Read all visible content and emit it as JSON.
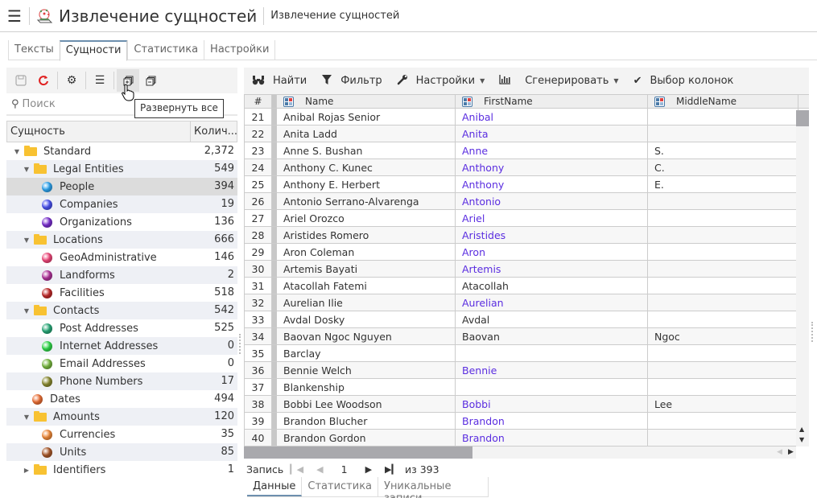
{
  "header": {
    "menu_icon": "hamburger-icon",
    "logo_icon": "entity-extraction-logo-icon",
    "title": "Извлечение сущностей",
    "subtitle": "Извлечение сущностей"
  },
  "top_tabs": [
    {
      "label": "Тексты",
      "active": false
    },
    {
      "label": "Сущности",
      "active": true
    },
    {
      "label": "Статистика",
      "active": false
    },
    {
      "label": "Настройки",
      "active": false
    }
  ],
  "left_toolbar": {
    "buttons": [
      {
        "icon": "save-icon",
        "disabled": true
      },
      {
        "icon": "refresh-icon"
      },
      {
        "icon": "gear-icon"
      },
      {
        "icon": "list-icon"
      },
      {
        "icon": "expand-all-icon",
        "hover": true
      },
      {
        "icon": "collapse-all-icon"
      }
    ],
    "tooltip": "Развернуть все"
  },
  "search": {
    "placeholder": "Поиск",
    "icon": "search-icon"
  },
  "tree": {
    "col_entity": "Сущность",
    "col_count": "Колич...",
    "rows": [
      {
        "label": "Standard",
        "count": "2,372",
        "type": "folder",
        "level": 0,
        "expanded": true
      },
      {
        "label": "Legal Entities",
        "count": "549",
        "type": "folder",
        "level": 1,
        "expanded": true
      },
      {
        "label": "People",
        "count": "394",
        "type": "entity",
        "level": 2,
        "color": "#2ea4ef",
        "selected": true
      },
      {
        "label": "Companies",
        "count": "19",
        "type": "entity",
        "level": 2,
        "color": "#4a52f0"
      },
      {
        "label": "Organizations",
        "count": "136",
        "type": "entity",
        "level": 2,
        "color": "#7a2fd0"
      },
      {
        "label": "Locations",
        "count": "666",
        "type": "folder",
        "level": 1,
        "expanded": true
      },
      {
        "label": "GeoAdministrative",
        "count": "146",
        "type": "entity",
        "level": 2,
        "color": "#f0477a"
      },
      {
        "label": "Landforms",
        "count": "2",
        "type": "entity",
        "level": 2,
        "color": "#b0329a"
      },
      {
        "label": "Facilities",
        "count": "518",
        "type": "entity",
        "level": 2,
        "color": "#c02a2a"
      },
      {
        "label": "Contacts",
        "count": "542",
        "type": "folder",
        "level": 1,
        "expanded": true
      },
      {
        "label": "Post Addresses",
        "count": "525",
        "type": "entity",
        "level": 2,
        "color": "#27a878"
      },
      {
        "label": "Internet Addresses",
        "count": "0",
        "type": "entity",
        "level": 2,
        "color": "#2fd84a"
      },
      {
        "label": "Email Addresses",
        "count": "0",
        "type": "entity",
        "level": 2,
        "color": "#78b840"
      },
      {
        "label": "Phone Numbers",
        "count": "17",
        "type": "entity",
        "level": 2,
        "color": "#8a8a30"
      },
      {
        "label": "Dates",
        "count": "494",
        "type": "entity",
        "level": 1,
        "color": "#ec6f35"
      },
      {
        "label": "Amounts",
        "count": "120",
        "type": "folder",
        "level": 1,
        "expanded": true
      },
      {
        "label": "Currencies",
        "count": "35",
        "type": "entity",
        "level": 2,
        "color": "#f08a3a"
      },
      {
        "label": "Units",
        "count": "85",
        "type": "entity",
        "level": 2,
        "color": "#a8582a"
      },
      {
        "label": "Identifiers",
        "count": "1",
        "type": "folder",
        "level": 1,
        "expanded": false
      }
    ]
  },
  "right_toolbar": [
    {
      "label": "Найти",
      "icon": "binoculars-icon",
      "dropdown": false
    },
    {
      "label": "Фильтр",
      "icon": "filter-icon",
      "dropdown": false
    },
    {
      "label": "Настройки",
      "icon": "wrench-icon",
      "dropdown": true
    },
    {
      "label": "Сгенерировать",
      "icon": "chart-icon",
      "dropdown": true
    },
    {
      "label": "Выбор колонок",
      "icon": "checkmark-icon",
      "dropdown": false
    }
  ],
  "grid": {
    "columns": [
      "#",
      "Name",
      "FirstName",
      "MiddleName"
    ],
    "rows": [
      {
        "n": "21",
        "name": "Anibal Rojas Senior",
        "first": "Anibal",
        "first_link": true,
        "middle": ""
      },
      {
        "n": "22",
        "name": "Anita Ladd",
        "first": "Anita",
        "first_link": true,
        "middle": ""
      },
      {
        "n": "23",
        "name": "Anne S. Bushan",
        "first": "Anne",
        "first_link": true,
        "middle": "S."
      },
      {
        "n": "24",
        "name": "Anthony C. Kunec",
        "first": "Anthony",
        "first_link": true,
        "middle": "C."
      },
      {
        "n": "25",
        "name": "Anthony E. Herbert",
        "first": "Anthony",
        "first_link": true,
        "middle": "E."
      },
      {
        "n": "26",
        "name": "Antonio Serrano-Alvarenga",
        "first": "Antonio",
        "first_link": true,
        "middle": ""
      },
      {
        "n": "27",
        "name": "Ariel Orozco",
        "first": "Ariel",
        "first_link": true,
        "middle": ""
      },
      {
        "n": "28",
        "name": "Aristides Romero",
        "first": "Aristides",
        "first_link": true,
        "middle": ""
      },
      {
        "n": "29",
        "name": "Aron Coleman",
        "first": "Aron",
        "first_link": true,
        "middle": ""
      },
      {
        "n": "30",
        "name": "Artemis Bayati",
        "first": "Artemis",
        "first_link": true,
        "middle": ""
      },
      {
        "n": "31",
        "name": "Atacollah Fatemi",
        "first": "Atacollah",
        "first_link": false,
        "middle": ""
      },
      {
        "n": "32",
        "name": "Aurelian Ilie",
        "first": "Aurelian",
        "first_link": true,
        "middle": ""
      },
      {
        "n": "33",
        "name": "Avdal Dosky",
        "first": "Avdal",
        "first_link": false,
        "middle": ""
      },
      {
        "n": "34",
        "name": "Baovan Ngoc Nguyen",
        "first": "Baovan",
        "first_link": false,
        "middle": "Ngoc"
      },
      {
        "n": "35",
        "name": "Barclay",
        "first": "",
        "first_link": false,
        "middle": ""
      },
      {
        "n": "36",
        "name": "Bennie Welch",
        "first": "Bennie",
        "first_link": true,
        "middle": ""
      },
      {
        "n": "37",
        "name": "Blankenship",
        "first": "",
        "first_link": false,
        "middle": ""
      },
      {
        "n": "38",
        "name": "Bobbi Lee Woodson",
        "first": "Bobbi",
        "first_link": true,
        "middle": "Lee"
      },
      {
        "n": "39",
        "name": "Brandon Blucher",
        "first": "Brandon",
        "first_link": true,
        "middle": ""
      },
      {
        "n": "40",
        "name": "Brandon Gordon",
        "first": "Brandon",
        "first_link": true,
        "middle": ""
      }
    ]
  },
  "pager": {
    "label": "Запись",
    "current": "1",
    "total": "из 393"
  },
  "bottom_tabs": [
    {
      "label": "Данные",
      "active": true
    },
    {
      "label": "Статистика",
      "active": false
    },
    {
      "label": "Уникальные записи",
      "active": false
    }
  ]
}
